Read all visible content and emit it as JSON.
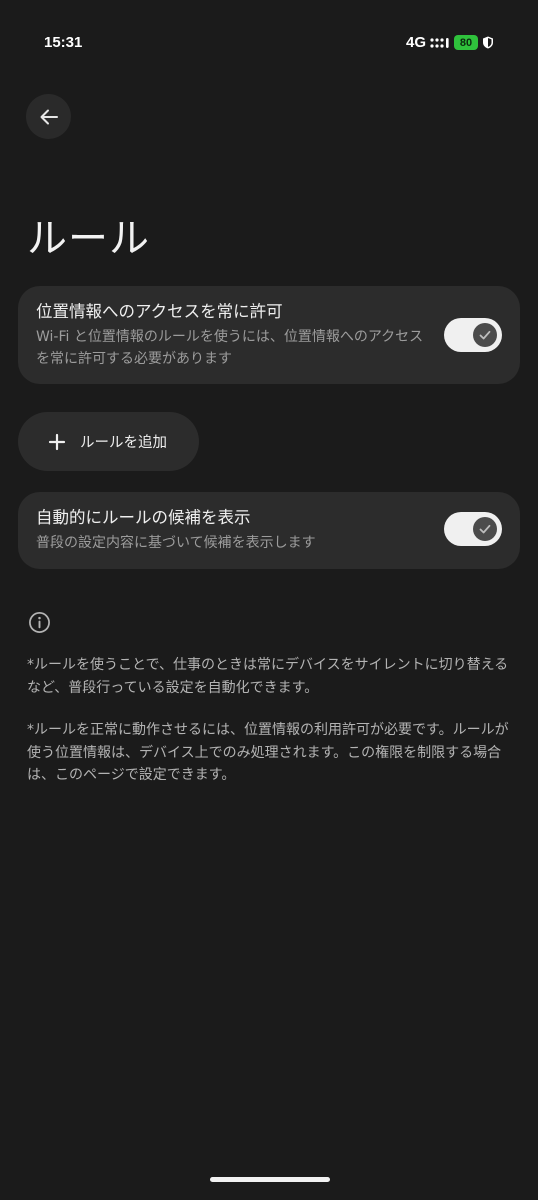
{
  "status_bar": {
    "time": "15:31",
    "network": "4G",
    "battery": "80",
    "icons": [
      "signal-icon",
      "shield-icon"
    ]
  },
  "header": {
    "back_icon": "arrow-left-icon",
    "title": "ルール"
  },
  "location_access": {
    "title": "位置情報へのアクセスを常に許可",
    "description": "Wi-Fi と位置情報のルールを使うには、位置情報へのアクセスを常に許可する必要があります",
    "enabled": true
  },
  "add_rule": {
    "icon": "plus-icon",
    "label": "ルールを追加"
  },
  "suggestions": {
    "title": "自動的にルールの候補を表示",
    "description": "普段の設定内容に基づいて候補を表示します",
    "enabled": true
  },
  "info": {
    "icon": "info-icon",
    "paragraph_1": "*ルールを使うことで、仕事のときは常にデバイスをサイレントに切り替えるなど、普段行っている設定を自動化できます。",
    "paragraph_2": "*ルールを正常に動作させるには、位置情報の利用許可が必要です。ルールが使う位置情報は、デバイス上でのみ処理されます。この権限を制限する場合は、このページで設定できます。"
  },
  "colors": {
    "background": "#1b1b1b",
    "card": "#2c2c2c",
    "battery": "#2fc23c",
    "toggle_track": "#f0f0f0"
  }
}
